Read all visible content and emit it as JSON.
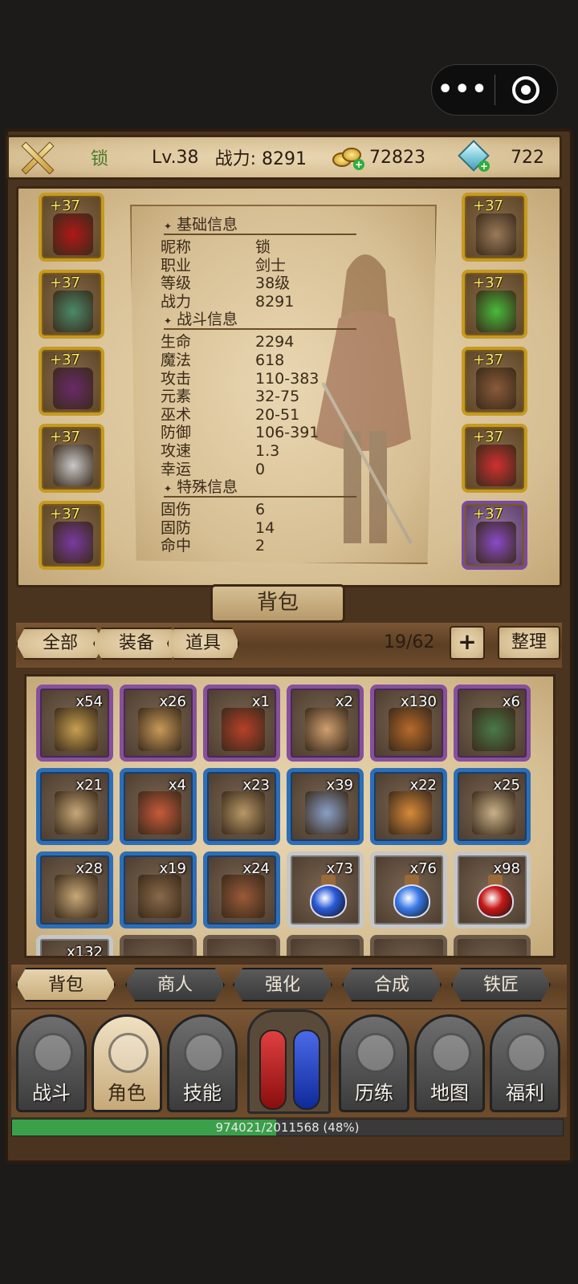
{
  "topbar": {
    "nickname": "锁",
    "level": "Lv.38",
    "power": "战力: 8291",
    "gold": "72823",
    "gems": "722"
  },
  "equipment": {
    "left": [
      {
        "plus": "+37",
        "icon": "blood-sword-icon",
        "color": "#b01818"
      },
      {
        "plus": "+37",
        "icon": "green-armor-icon",
        "color": "#4a8a6a"
      },
      {
        "plus": "+37",
        "icon": "claw-gauntlet-icon",
        "color": "#6a2a6a"
      },
      {
        "plus": "+37",
        "icon": "silver-ring-icon",
        "color": "#c8c8c8"
      },
      {
        "plus": "+37",
        "icon": "purple-belt-icon",
        "color": "#7a3aa0"
      }
    ],
    "right": [
      {
        "plus": "+37",
        "icon": "helmet-icon",
        "color": "#9a7a5a"
      },
      {
        "plus": "+37",
        "icon": "green-amulet-icon",
        "color": "#4aba3a"
      },
      {
        "plus": "+37",
        "icon": "bracer-icon",
        "color": "#8a5a3a"
      },
      {
        "plus": "+37",
        "icon": "ruby-ring-icon",
        "color": "#d03030"
      },
      {
        "plus": "+37",
        "icon": "purple-boots-icon",
        "color": "#8a4ac8"
      }
    ]
  },
  "stats": {
    "basic_title": "基础信息",
    "basic": [
      {
        "k": "昵称",
        "v": "锁"
      },
      {
        "k": "职业",
        "v": "剑士"
      },
      {
        "k": "等级",
        "v": "38级"
      },
      {
        "k": "战力",
        "v": "8291"
      }
    ],
    "combat_title": "战斗信息",
    "combat": [
      {
        "k": "生命",
        "v": "2294"
      },
      {
        "k": "魔法",
        "v": "618"
      },
      {
        "k": "攻击",
        "v": "110-383"
      },
      {
        "k": "元素",
        "v": "32-75"
      },
      {
        "k": "巫术",
        "v": "20-51"
      },
      {
        "k": "防御",
        "v": "106-391"
      },
      {
        "k": "攻速",
        "v": "1.3"
      },
      {
        "k": "幸运",
        "v": "0"
      }
    ],
    "special_title": "特殊信息",
    "special": [
      {
        "k": "固伤",
        "v": "6"
      },
      {
        "k": "固防",
        "v": "14"
      },
      {
        "k": "命中",
        "v": "2"
      }
    ]
  },
  "backpack": {
    "title": "背包",
    "filters": [
      "全部",
      "装备",
      "道具"
    ],
    "count": "19/62",
    "add": "+",
    "sort": "整理",
    "items": [
      {
        "qty": "x54",
        "rarity": "purple",
        "icon": "pocket-watch-icon",
        "color": "#c8a050"
      },
      {
        "qty": "x26",
        "rarity": "purple",
        "icon": "scroll-icon",
        "color": "#c89a5a"
      },
      {
        "qty": "x1",
        "rarity": "purple",
        "icon": "gift-box-icon",
        "color": "#b8402a"
      },
      {
        "qty": "x2",
        "rarity": "purple",
        "icon": "rune-map-icon",
        "color": "#d0a070"
      },
      {
        "qty": "x130",
        "rarity": "purple",
        "icon": "coin-bag-icon",
        "color": "#b86a2a"
      },
      {
        "qty": "x6",
        "rarity": "purple",
        "icon": "rune-stone-icon",
        "color": "#4a7a4a"
      },
      {
        "qty": "x21",
        "rarity": "blue",
        "icon": "compass-map-icon",
        "color": "#c8a878"
      },
      {
        "qty": "x4",
        "rarity": "blue",
        "icon": "fire-scroll-icon",
        "color": "#c85a3a"
      },
      {
        "qty": "x23",
        "rarity": "blue",
        "icon": "rune-parchment-icon",
        "color": "#b89868"
      },
      {
        "qty": "x39",
        "rarity": "blue",
        "icon": "spell-book-icon",
        "color": "#8aa0c8"
      },
      {
        "qty": "x22",
        "rarity": "blue",
        "icon": "flame-scroll-icon",
        "color": "#d88a3a"
      },
      {
        "qty": "x25",
        "rarity": "blue",
        "icon": "wind-scroll-icon",
        "color": "#c8b088"
      },
      {
        "qty": "x28",
        "rarity": "blue",
        "icon": "magic-scroll-icon",
        "color": "#c8a878"
      },
      {
        "qty": "x19",
        "rarity": "blue",
        "icon": "moon-tome-icon",
        "color": "#8a6a4a"
      },
      {
        "qty": "x24",
        "rarity": "blue",
        "icon": "ancient-tome-icon",
        "color": "#9a5a3a"
      },
      {
        "qty": "x73",
        "rarity": "white",
        "icon": "blue-potion-icon",
        "color": "#2a5ad8"
      },
      {
        "qty": "x76",
        "rarity": "white",
        "icon": "blue-potion-icon",
        "color": "#3a7ae8"
      },
      {
        "qty": "x98",
        "rarity": "white",
        "icon": "red-potion-icon",
        "color": "#c81818"
      },
      {
        "qty": "x132",
        "rarity": "white",
        "icon": "unknown-item-icon",
        "color": "#8a6a4a"
      }
    ]
  },
  "subnav": [
    "背包",
    "商人",
    "强化",
    "合成",
    "铁匠"
  ],
  "mainnav": [
    {
      "label": "战斗",
      "icon": "crossed-swords-icon"
    },
    {
      "label": "角色",
      "icon": "trident-icon"
    },
    {
      "label": "技能",
      "icon": "demon-mask-icon"
    },
    {
      "label": "历练",
      "icon": "spiral-icon"
    },
    {
      "label": "地图",
      "icon": "map-icon"
    },
    {
      "label": "福利",
      "icon": "treasure-chest-icon"
    }
  ],
  "exp": {
    "text": "974021/2011568 (48%)",
    "fraction": 0.48
  }
}
